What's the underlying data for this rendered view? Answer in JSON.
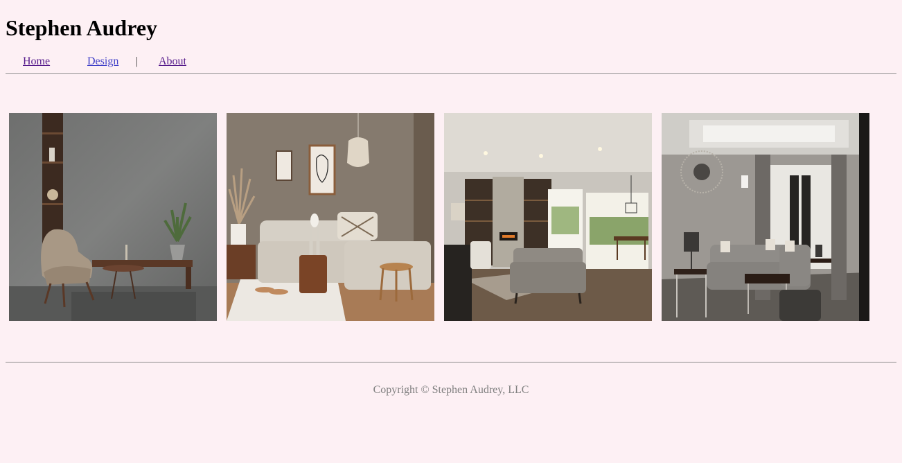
{
  "header": {
    "title": "Stephen Audrey"
  },
  "nav": {
    "items": [
      {
        "label": "Home"
      },
      {
        "label": "Design"
      },
      {
        "label": "About"
      }
    ],
    "separator": "|"
  },
  "gallery": {
    "photos": [
      {
        "subject": "armchair-concrete-wall"
      },
      {
        "subject": "sectional-sofa-neutral-room"
      },
      {
        "subject": "living-room-fireplace"
      },
      {
        "subject": "grey-sectional-living-room"
      }
    ]
  },
  "footer": {
    "copyright": "Copyright © Stephen Audrey, LLC"
  }
}
